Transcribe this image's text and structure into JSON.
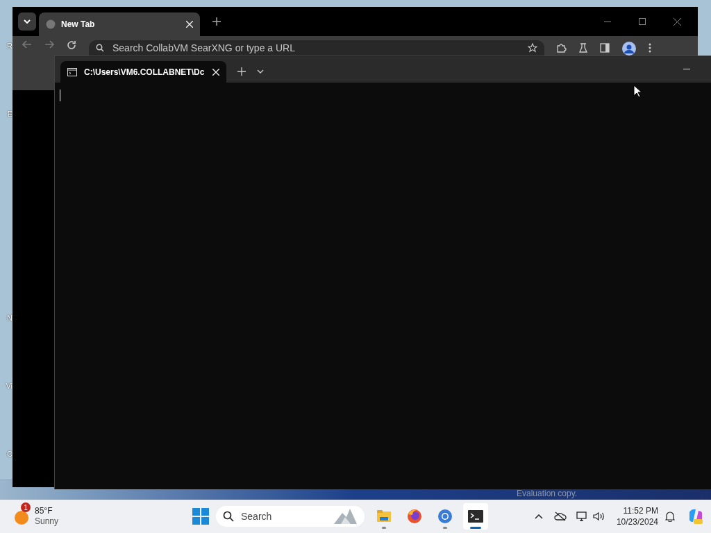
{
  "desktop_icons": [
    {
      "label": "R"
    },
    {
      "label": "E"
    },
    {
      "label": "N"
    },
    {
      "label": "Vi"
    },
    {
      "label": "C"
    }
  ],
  "browser": {
    "tabs": [
      {
        "title": "New Tab",
        "selected": true
      }
    ],
    "address_bar": {
      "placeholder": "Search CollabVM SearXNG or type a URL"
    }
  },
  "terminal": {
    "tabs": [
      {
        "title": "C:\\Users\\VM6.COLLABNET\\Dc",
        "selected": true
      }
    ]
  },
  "watermark_text": "Evaluation copy.",
  "taskbar": {
    "weather": {
      "badge": "1",
      "temperature": "85°F",
      "condition": "Sunny"
    },
    "search": {
      "placeholder": "Search"
    },
    "apps": [
      {
        "kind": "files",
        "running": true,
        "active": false
      },
      {
        "kind": "firefox",
        "running": false,
        "active": false
      },
      {
        "kind": "chrome",
        "running": true,
        "active": false
      },
      {
        "kind": "terminal",
        "running": true,
        "active": true
      }
    ],
    "clock": {
      "time": "11:52 PM",
      "date": "10/23/2024"
    }
  }
}
